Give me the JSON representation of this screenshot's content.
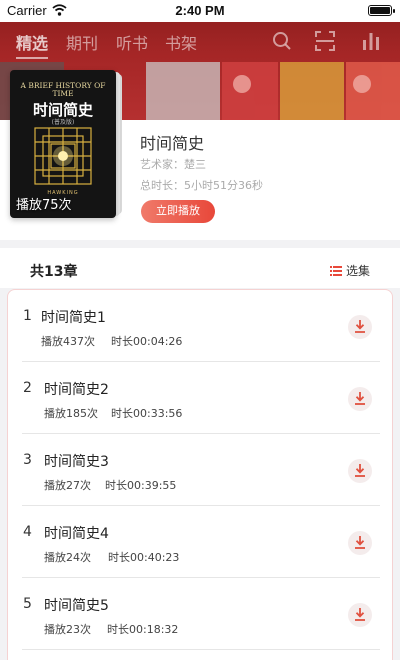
{
  "status_bar": {
    "carrier": "Carrier",
    "time": "2:40 PM"
  },
  "nav": {
    "tabs": [
      {
        "label": "精选",
        "active": true
      },
      {
        "label": "期刊",
        "active": false
      },
      {
        "label": "听书",
        "active": false
      },
      {
        "label": "书架",
        "active": false
      }
    ],
    "icons": [
      "search-icon",
      "scan-icon",
      "chart-icon"
    ]
  },
  "cover": {
    "title_en": "A BRIEF HISTORY OF TIME",
    "title_cn": "时间简史",
    "subtitle": "(普及版)",
    "author": "HAWKING",
    "plays": "播放75次"
  },
  "album": {
    "title": "时间简史",
    "artist": "艺术家：楚三",
    "duration": "总时长：5小时51分36秒",
    "play_button": "立即播放"
  },
  "list": {
    "count": "共13章",
    "select_label": "选集",
    "chapters": [
      {
        "num": "1",
        "title": "时间简史1",
        "plays": "播放437次",
        "duration": "时长00:04:26"
      },
      {
        "num": "2",
        "title": "时间简史2",
        "plays": "播放185次",
        "duration": "时长00:33:56"
      },
      {
        "num": "3",
        "title": "时间简史3",
        "plays": "播放27次",
        "duration": "时长00:39:55"
      },
      {
        "num": "4",
        "title": "时间简史4",
        "plays": "播放24次",
        "duration": "时长00:40:23"
      },
      {
        "num": "5",
        "title": "时间简史5",
        "plays": "播放23次",
        "duration": "时长00:18:32"
      }
    ]
  },
  "colors": {
    "accent": "#e8483a",
    "header": "#a52626"
  }
}
